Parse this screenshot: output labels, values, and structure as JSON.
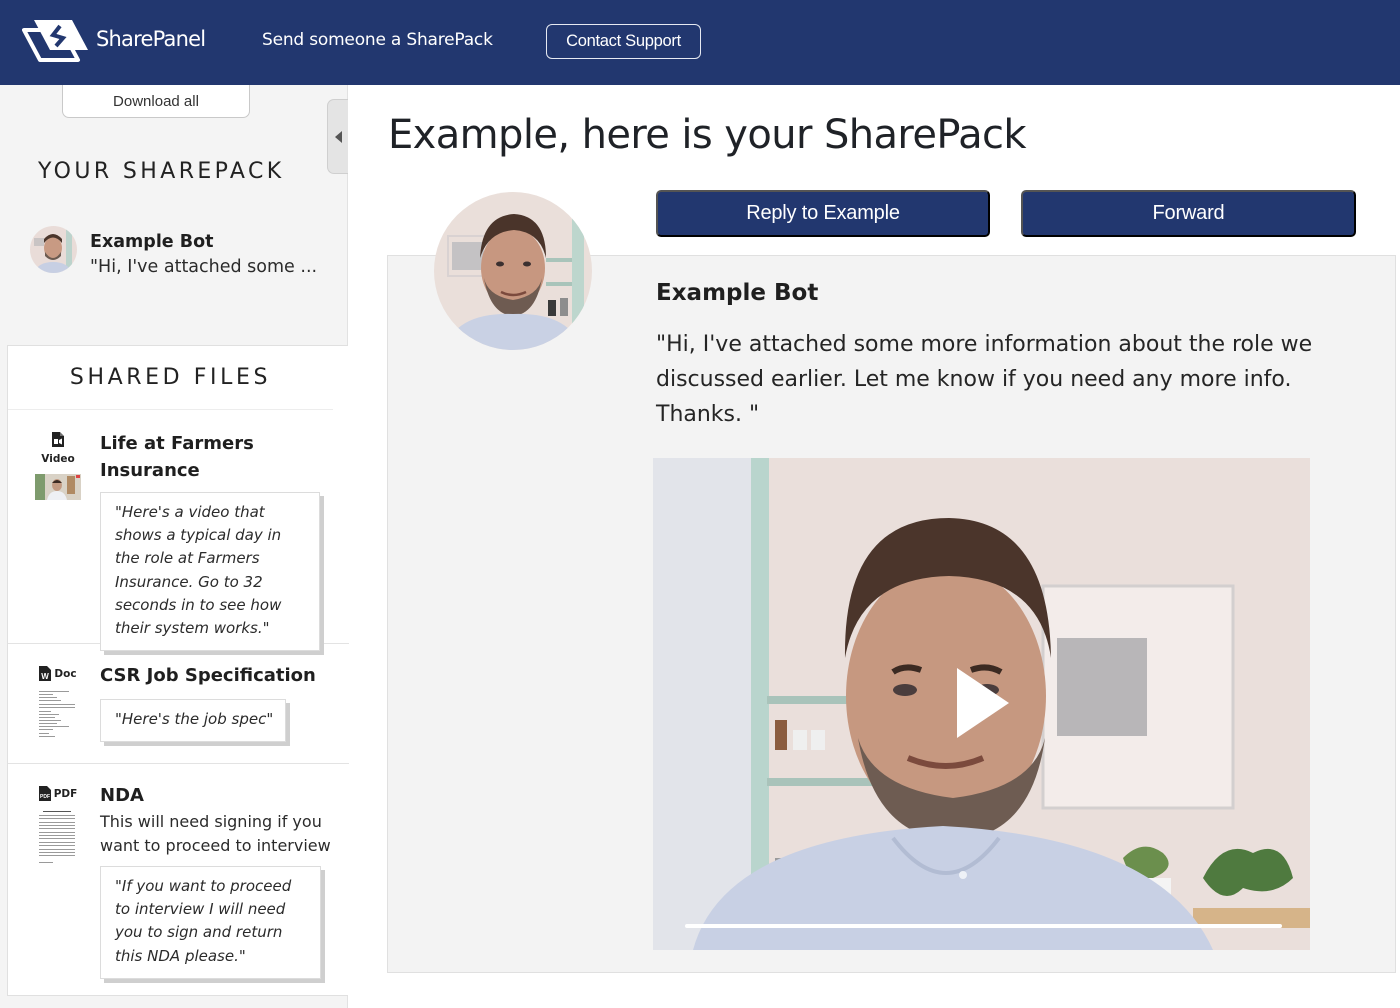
{
  "header": {
    "brand": "SharePanel",
    "nav_send": "Send someone a SharePack",
    "contact_support": "Contact Support",
    "brand_color": "#22376f"
  },
  "sidebar": {
    "download_all": "Download all",
    "collapse_icon": "caret-left-icon",
    "section_title": "YOUR SHAREPACK",
    "sender": {
      "name": "Example Bot",
      "preview": "\"Hi, I've attached some ..."
    },
    "files_title": "SHARED FILES",
    "files": [
      {
        "type_icon": "file-video-icon",
        "type_label": "Video",
        "title": "Life at Farmers Insurance",
        "description": "",
        "note": "\"Here's a video that shows a typical day in the role at Farmers Insurance. Go to 32 seconds in to see how their system works.\""
      },
      {
        "type_icon": "file-word-icon",
        "type_label": "Doc",
        "title": "CSR Job Specification",
        "description": "",
        "note": "\"Here's the job spec\""
      },
      {
        "type_icon": "file-pdf-icon",
        "type_label": "PDF",
        "title": "NDA",
        "description": "This will need signing if you want to proceed to interview",
        "note": "\"If you want to proceed to interview I will need you to sign and return this NDA please.\""
      }
    ]
  },
  "main": {
    "title": "Example, here is your SharePack",
    "reply_button": "Reply to Example",
    "forward_button": "Forward",
    "message": {
      "sender": "Example Bot",
      "body": "\"Hi, I've attached some more information about the role we discussed earlier. Let me know if you need any more info. Thanks. \""
    },
    "video": {
      "play_icon": "play-icon",
      "progress_percent": 0
    }
  }
}
